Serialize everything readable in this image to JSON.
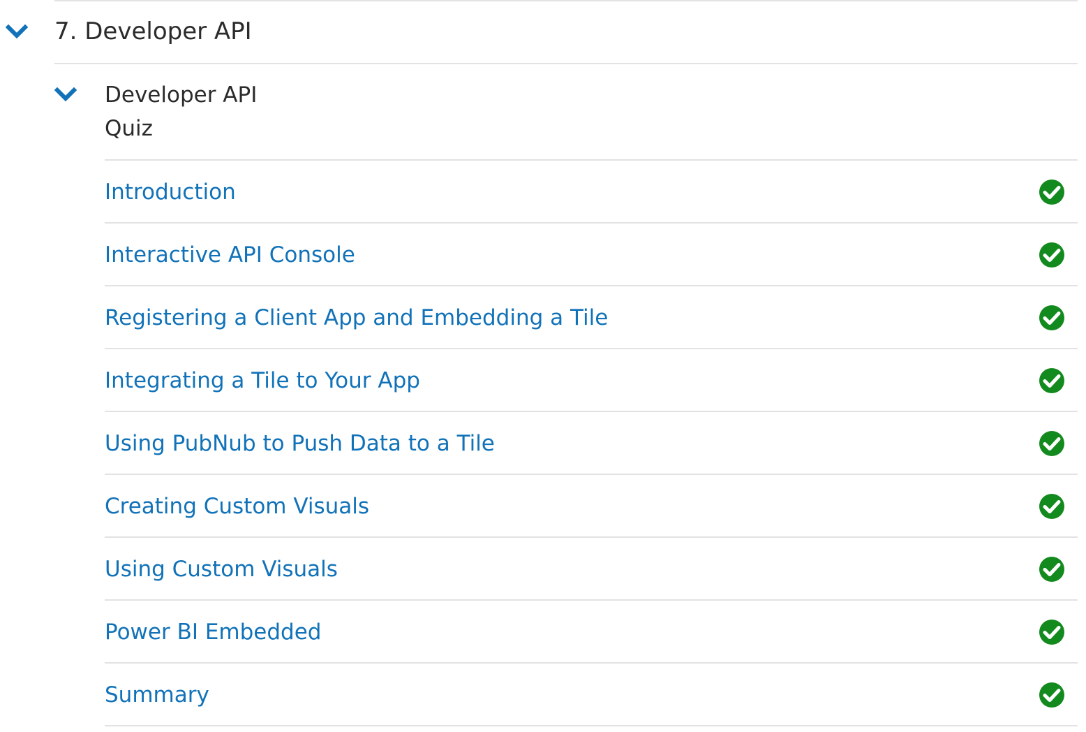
{
  "colors": {
    "accent": "#1172b8",
    "check": "#138a1e",
    "divider": "#e2e2e2",
    "text": "#2b2b2b"
  },
  "section": {
    "title": "7. Developer API",
    "expand_icon": "chevron-down-icon",
    "expanded": true
  },
  "module": {
    "title": "Developer API",
    "subtitle": "Quiz",
    "expand_icon": "chevron-down-icon",
    "expanded": true
  },
  "lessons": [
    {
      "label": "Introduction",
      "status": "completed",
      "status_icon": "check-circle-icon"
    },
    {
      "label": "Interactive API Console",
      "status": "completed",
      "status_icon": "check-circle-icon"
    },
    {
      "label": "Registering a Client App and Embedding a Tile",
      "status": "completed",
      "status_icon": "check-circle-icon"
    },
    {
      "label": "Integrating a Tile to Your App",
      "status": "completed",
      "status_icon": "check-circle-icon"
    },
    {
      "label": "Using PubNub to Push Data to a Tile",
      "status": "completed",
      "status_icon": "check-circle-icon"
    },
    {
      "label": "Creating Custom Visuals",
      "status": "completed",
      "status_icon": "check-circle-icon"
    },
    {
      "label": "Using Custom Visuals",
      "status": "completed",
      "status_icon": "check-circle-icon"
    },
    {
      "label": "Power BI Embedded",
      "status": "completed",
      "status_icon": "check-circle-icon"
    },
    {
      "label": "Summary",
      "status": "completed",
      "status_icon": "check-circle-icon"
    }
  ]
}
